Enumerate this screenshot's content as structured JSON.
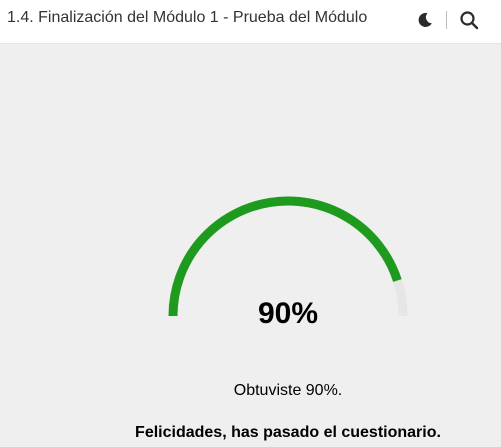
{
  "header": {
    "title": "1.4. Finalización del Módulo 1 - Prueba del Módulo",
    "icons": [
      "moon-icon",
      "search-icon"
    ]
  },
  "result": {
    "score_percent": 90,
    "score_label": "90%",
    "score_text": "Obtuviste 90%.",
    "pass_text": "Felicidades, has pasado el cuestionario."
  },
  "colors": {
    "gauge_fill": "#1e9a1e",
    "gauge_track": "#e6e6e6",
    "background": "#efefef"
  }
}
